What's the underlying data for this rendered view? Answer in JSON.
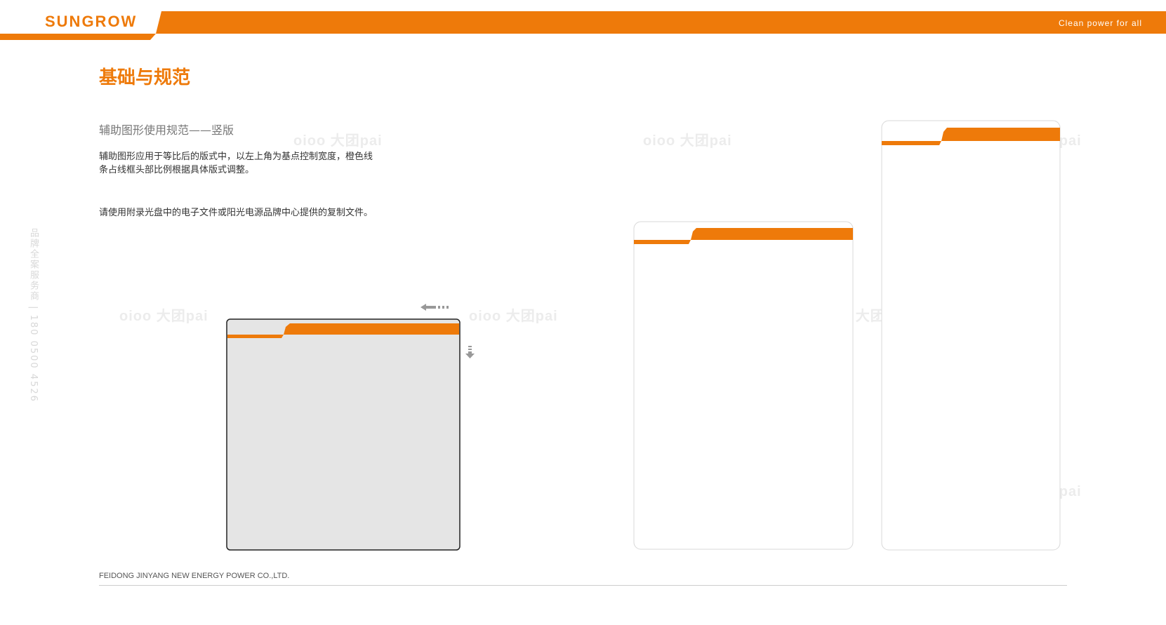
{
  "header": {
    "logo": "SUNGROW",
    "tagline": "Clean power for all"
  },
  "page": {
    "title": "基础与规范",
    "subtitle": "辅助图形使用规范——竖版",
    "description_line1": "辅助图形应用于等比后的版式中，以左上角为基点控制宽度，橙色线",
    "description_line2": "条占线框头部比例根据具体版式调整。",
    "note": "请使用附录光盘中的电子文件或阳光电源品牌中心提供的复制文件。"
  },
  "side_text": "品牌全案服务商 | 180 0500 4526",
  "watermark": "oioo 大团pai",
  "footer": {
    "company": "FEIDONG JINYANG NEW ENERGY POWER CO.,LTD."
  },
  "colors": {
    "brand_orange": "#ee7a0a",
    "panel_gray": "#e5e5e5"
  },
  "icons": [
    "arrow-left-icon",
    "arrow-down-icon"
  ]
}
